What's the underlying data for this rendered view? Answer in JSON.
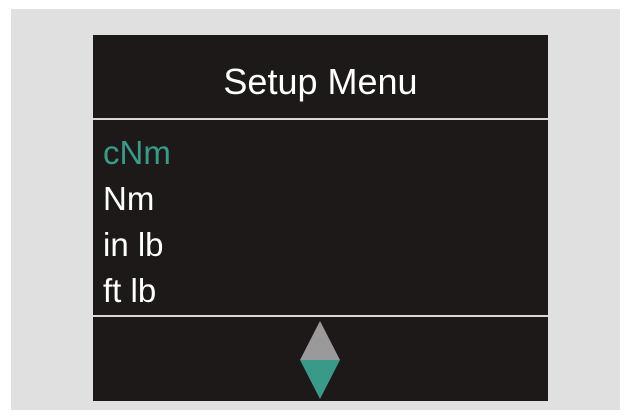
{
  "screen": {
    "title": "Setup Menu"
  },
  "menu": {
    "items": [
      {
        "label": "cNm",
        "selected": true
      },
      {
        "label": "Nm",
        "selected": false
      },
      {
        "label": "in lb",
        "selected": false
      },
      {
        "label": "ft lb",
        "selected": false
      }
    ]
  },
  "scroll_indicator": {
    "up_arrow_icon": "triangle-up-icon",
    "down_arrow_icon": "triangle-down-icon",
    "up_color": "#9a9a9a",
    "down_color": "#3a9a8a"
  },
  "colors": {
    "screen_background": "#1e1919",
    "selected_text": "#3a9a8a",
    "normal_text": "#ffffff",
    "bezel": "#e0e0e0"
  }
}
